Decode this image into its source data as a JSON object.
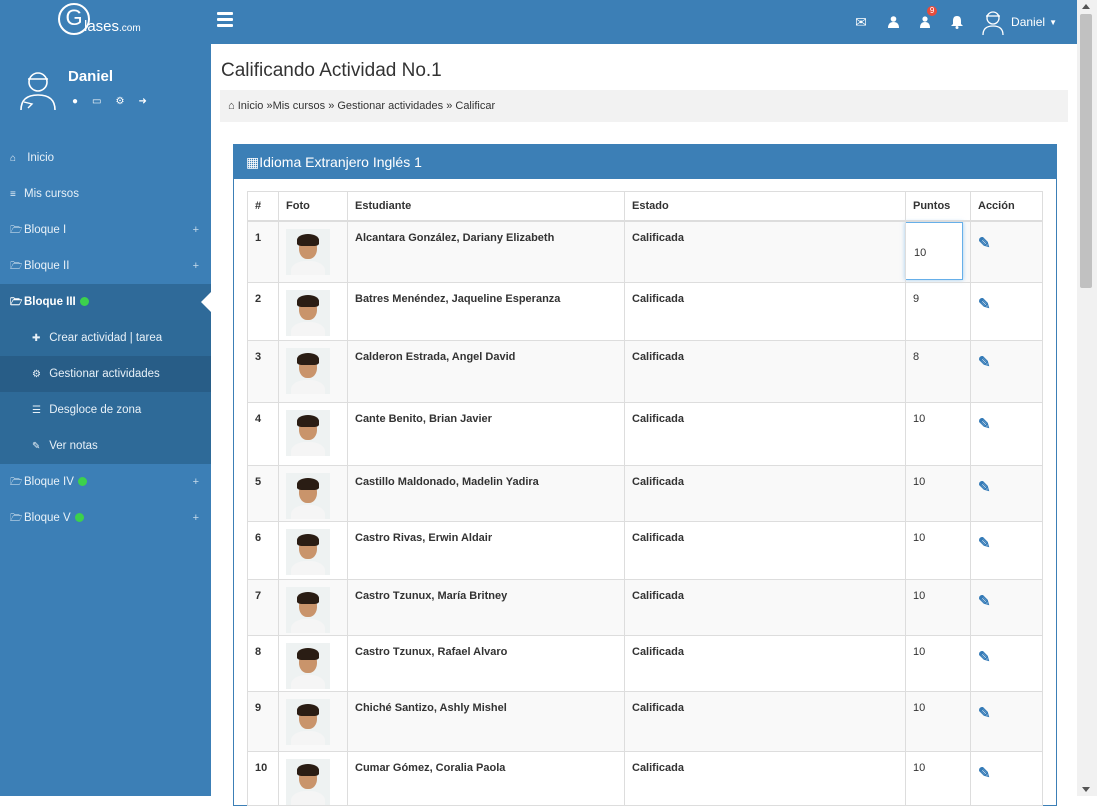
{
  "brand": {
    "logo_letter": "G",
    "logo_text": "lases",
    "logo_suffix": ".com"
  },
  "topbar": {
    "notification_count": "9",
    "user_name": "Daniel"
  },
  "sidebar": {
    "user_name": "Daniel",
    "items": [
      {
        "label": "Inicio",
        "icon": "home-icon"
      },
      {
        "label": "Mis cursos",
        "icon": "list-icon"
      },
      {
        "label": "Bloque I",
        "icon": "folder-open-icon"
      },
      {
        "label": "Bloque II",
        "icon": "folder-open-icon"
      },
      {
        "label": "Bloque III",
        "icon": "folder-open-icon"
      },
      {
        "label": "Bloque IV",
        "icon": "folder-open-icon"
      },
      {
        "label": "Bloque V",
        "icon": "folder-open-icon"
      }
    ],
    "sub_items": [
      {
        "label": "Crear actividad | tarea",
        "icon": "plus-icon"
      },
      {
        "label": "Gestionar actividades",
        "icon": "gear-icon"
      },
      {
        "label": "Desgloce de zona",
        "icon": "list-ul-icon"
      },
      {
        "label": "Ver notas",
        "icon": "edit-icon"
      }
    ]
  },
  "main": {
    "title": "Calificando Actividad No.1",
    "breadcrumb": "Inicio »Mis cursos » Gestionar actividades » Calificar",
    "panel_title": "Idioma Extranjero Inglés 1"
  },
  "table": {
    "headers": [
      "#",
      "Foto",
      "Estudiante",
      "Estado",
      "Puntos",
      "Acción"
    ],
    "rows": [
      {
        "n": "1",
        "name": "Alcantara González, Dariany Elizabeth",
        "status": "Calificada",
        "points": "10"
      },
      {
        "n": "2",
        "name": "Batres Menéndez, Jaqueline Esperanza",
        "status": "Calificada",
        "points": "9"
      },
      {
        "n": "3",
        "name": "Calderon Estrada, Angel David",
        "status": "Calificada",
        "points": "8"
      },
      {
        "n": "4",
        "name": "Cante Benito, Brian Javier",
        "status": "Calificada",
        "points": "10"
      },
      {
        "n": "5",
        "name": "Castillo Maldonado, Madelin Yadira",
        "status": "Calificada",
        "points": "10"
      },
      {
        "n": "6",
        "name": "Castro Rivas, Erwin Aldair",
        "status": "Calificada",
        "points": "10"
      },
      {
        "n": "7",
        "name": "Castro Tzunux, María Britney",
        "status": "Calificada",
        "points": "10"
      },
      {
        "n": "8",
        "name": "Castro Tzunux, Rafael Alvaro",
        "status": "Calificada",
        "points": "10"
      },
      {
        "n": "9",
        "name": "Chiché Santizo, Ashly Mishel",
        "status": "Calificada",
        "points": "10"
      },
      {
        "n": "10",
        "name": "Cumar Gómez, Coralia Paola",
        "status": "Calificada",
        "points": "10"
      }
    ]
  },
  "colors": {
    "primary": "#3c7fb6",
    "sidebar_active": "#2f6a99",
    "online_dot": "#3cd14c",
    "badge": "#e74c3c",
    "link": "#337ab7"
  }
}
